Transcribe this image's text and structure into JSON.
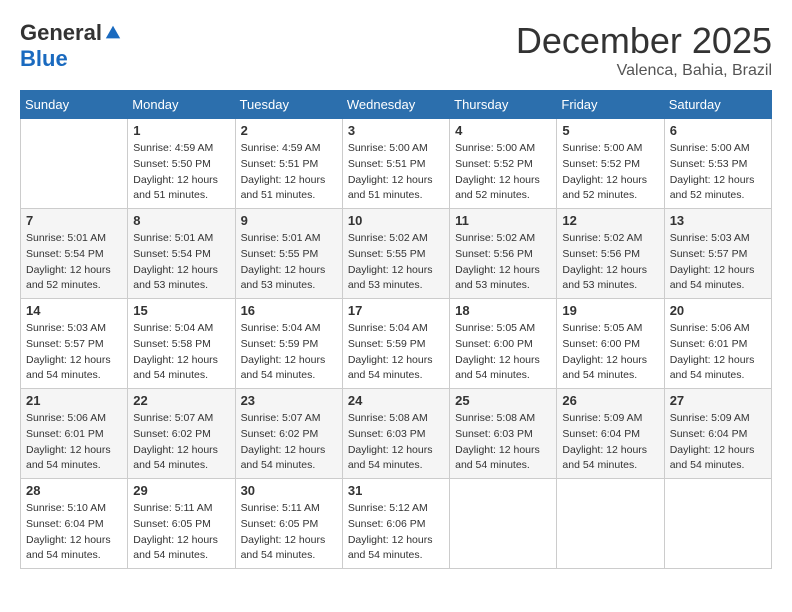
{
  "logo": {
    "general": "General",
    "blue": "Blue"
  },
  "title": "December 2025",
  "location": "Valenca, Bahia, Brazil",
  "days_of_week": [
    "Sunday",
    "Monday",
    "Tuesday",
    "Wednesday",
    "Thursday",
    "Friday",
    "Saturday"
  ],
  "weeks": [
    [
      {
        "day": null,
        "info": null
      },
      {
        "day": "1",
        "info": "Sunrise: 4:59 AM\nSunset: 5:50 PM\nDaylight: 12 hours\nand 51 minutes."
      },
      {
        "day": "2",
        "info": "Sunrise: 4:59 AM\nSunset: 5:51 PM\nDaylight: 12 hours\nand 51 minutes."
      },
      {
        "day": "3",
        "info": "Sunrise: 5:00 AM\nSunset: 5:51 PM\nDaylight: 12 hours\nand 51 minutes."
      },
      {
        "day": "4",
        "info": "Sunrise: 5:00 AM\nSunset: 5:52 PM\nDaylight: 12 hours\nand 52 minutes."
      },
      {
        "day": "5",
        "info": "Sunrise: 5:00 AM\nSunset: 5:52 PM\nDaylight: 12 hours\nand 52 minutes."
      },
      {
        "day": "6",
        "info": "Sunrise: 5:00 AM\nSunset: 5:53 PM\nDaylight: 12 hours\nand 52 minutes."
      }
    ],
    [
      {
        "day": "7",
        "info": "Sunrise: 5:01 AM\nSunset: 5:54 PM\nDaylight: 12 hours\nand 52 minutes."
      },
      {
        "day": "8",
        "info": "Sunrise: 5:01 AM\nSunset: 5:54 PM\nDaylight: 12 hours\nand 53 minutes."
      },
      {
        "day": "9",
        "info": "Sunrise: 5:01 AM\nSunset: 5:55 PM\nDaylight: 12 hours\nand 53 minutes."
      },
      {
        "day": "10",
        "info": "Sunrise: 5:02 AM\nSunset: 5:55 PM\nDaylight: 12 hours\nand 53 minutes."
      },
      {
        "day": "11",
        "info": "Sunrise: 5:02 AM\nSunset: 5:56 PM\nDaylight: 12 hours\nand 53 minutes."
      },
      {
        "day": "12",
        "info": "Sunrise: 5:02 AM\nSunset: 5:56 PM\nDaylight: 12 hours\nand 53 minutes."
      },
      {
        "day": "13",
        "info": "Sunrise: 5:03 AM\nSunset: 5:57 PM\nDaylight: 12 hours\nand 54 minutes."
      }
    ],
    [
      {
        "day": "14",
        "info": "Sunrise: 5:03 AM\nSunset: 5:57 PM\nDaylight: 12 hours\nand 54 minutes."
      },
      {
        "day": "15",
        "info": "Sunrise: 5:04 AM\nSunset: 5:58 PM\nDaylight: 12 hours\nand 54 minutes."
      },
      {
        "day": "16",
        "info": "Sunrise: 5:04 AM\nSunset: 5:59 PM\nDaylight: 12 hours\nand 54 minutes."
      },
      {
        "day": "17",
        "info": "Sunrise: 5:04 AM\nSunset: 5:59 PM\nDaylight: 12 hours\nand 54 minutes."
      },
      {
        "day": "18",
        "info": "Sunrise: 5:05 AM\nSunset: 6:00 PM\nDaylight: 12 hours\nand 54 minutes."
      },
      {
        "day": "19",
        "info": "Sunrise: 5:05 AM\nSunset: 6:00 PM\nDaylight: 12 hours\nand 54 minutes."
      },
      {
        "day": "20",
        "info": "Sunrise: 5:06 AM\nSunset: 6:01 PM\nDaylight: 12 hours\nand 54 minutes."
      }
    ],
    [
      {
        "day": "21",
        "info": "Sunrise: 5:06 AM\nSunset: 6:01 PM\nDaylight: 12 hours\nand 54 minutes."
      },
      {
        "day": "22",
        "info": "Sunrise: 5:07 AM\nSunset: 6:02 PM\nDaylight: 12 hours\nand 54 minutes."
      },
      {
        "day": "23",
        "info": "Sunrise: 5:07 AM\nSunset: 6:02 PM\nDaylight: 12 hours\nand 54 minutes."
      },
      {
        "day": "24",
        "info": "Sunrise: 5:08 AM\nSunset: 6:03 PM\nDaylight: 12 hours\nand 54 minutes."
      },
      {
        "day": "25",
        "info": "Sunrise: 5:08 AM\nSunset: 6:03 PM\nDaylight: 12 hours\nand 54 minutes."
      },
      {
        "day": "26",
        "info": "Sunrise: 5:09 AM\nSunset: 6:04 PM\nDaylight: 12 hours\nand 54 minutes."
      },
      {
        "day": "27",
        "info": "Sunrise: 5:09 AM\nSunset: 6:04 PM\nDaylight: 12 hours\nand 54 minutes."
      }
    ],
    [
      {
        "day": "28",
        "info": "Sunrise: 5:10 AM\nSunset: 6:04 PM\nDaylight: 12 hours\nand 54 minutes."
      },
      {
        "day": "29",
        "info": "Sunrise: 5:11 AM\nSunset: 6:05 PM\nDaylight: 12 hours\nand 54 minutes."
      },
      {
        "day": "30",
        "info": "Sunrise: 5:11 AM\nSunset: 6:05 PM\nDaylight: 12 hours\nand 54 minutes."
      },
      {
        "day": "31",
        "info": "Sunrise: 5:12 AM\nSunset: 6:06 PM\nDaylight: 12 hours\nand 54 minutes."
      },
      {
        "day": null,
        "info": null
      },
      {
        "day": null,
        "info": null
      },
      {
        "day": null,
        "info": null
      }
    ]
  ]
}
